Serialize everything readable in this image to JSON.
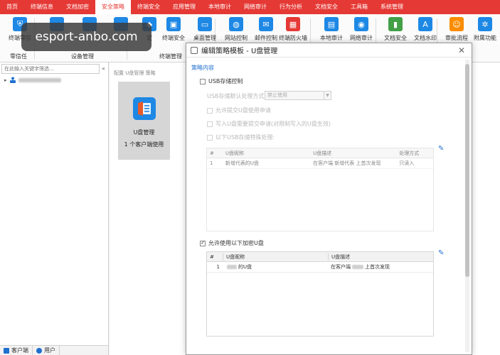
{
  "menu": [
    "首页",
    "终端信息",
    "文档加密",
    "安全策略",
    "终端安全",
    "应用管理",
    "本地审计",
    "网络审计",
    "行为分析",
    "文档安全",
    "工具箱",
    "系统管理"
  ],
  "menu_active": "安全策略",
  "ribbon": {
    "buttons": [
      {
        "label": "终端零信",
        "icon": "shield-icon",
        "color": "#1e88e5"
      },
      {
        "label": "终端安全",
        "icon": "monitor-shield-icon",
        "color": "#1e88e5"
      },
      {
        "label": "桌面管理",
        "icon": "desktop-icon",
        "color": "#1e88e5"
      },
      {
        "label": "网站控制",
        "icon": "globe-icon",
        "color": "#1e88e5"
      },
      {
        "label": "邮件控制",
        "icon": "mail-icon",
        "color": "#1e88e5"
      },
      {
        "label": "终端防火墙",
        "icon": "firewall-icon",
        "color": "#e53935"
      },
      {
        "label": "本地审计",
        "icon": "monitor-audit-icon",
        "color": "#1e88e5"
      },
      {
        "label": "网络审计",
        "icon": "network-audit-icon",
        "color": "#1e88e5"
      },
      {
        "label": "文档安全",
        "icon": "doc-shield-icon",
        "color": "#43a047"
      },
      {
        "label": "文档水印",
        "icon": "doc-watermark-icon",
        "color": "#1e88e5"
      },
      {
        "label": "审批流程",
        "icon": "approval-icon",
        "color": "#fb8c00"
      },
      {
        "label": "附属功能",
        "icon": "gear-icon",
        "color": "#1e88e5"
      }
    ],
    "partial_label": "定",
    "groups": [
      "零信任",
      "设备管理",
      "终端管理"
    ]
  },
  "watermark": "esport-anbo.com",
  "left": {
    "search_placeholder": "在此输入关键字筛选...",
    "collapse": "«",
    "tabs": [
      "客户端",
      "用户"
    ]
  },
  "content": {
    "breadcrumb": "配置 U盘管理 策略",
    "tile_name": "U盘管理",
    "tile_count": "1 个客户端使用"
  },
  "dialog": {
    "title": "编辑策略模板 - U盘管理",
    "close": "✕",
    "section": "策略内容",
    "usb_control": "USB存储控制",
    "default_label": "USB存储默认处理方式",
    "default_value": "禁止使用",
    "opt1": "允许提交U盘使用申请",
    "opt2": "写入U盘需要提交申请(对限制写入的U盘生效)",
    "opt3": "以下USB存储特殊处理:",
    "table1": {
      "headers": [
        "#",
        "U盘昵称",
        "U盘描述",
        "处理方式"
      ],
      "row": [
        "1",
        "新增代表的U盘",
        "在客户端 新增代表 上首次发现",
        "只读入"
      ]
    },
    "allow_encrypted": "允许使用以下加密U盘",
    "allow_checked": "✓",
    "table2": {
      "headers": [
        "#",
        "U盘昵称",
        "U盘描述"
      ],
      "row": {
        "num": "1",
        "name": "的U盘",
        "desc_a": "在客户端",
        "desc_b": "上首次发现"
      }
    }
  }
}
